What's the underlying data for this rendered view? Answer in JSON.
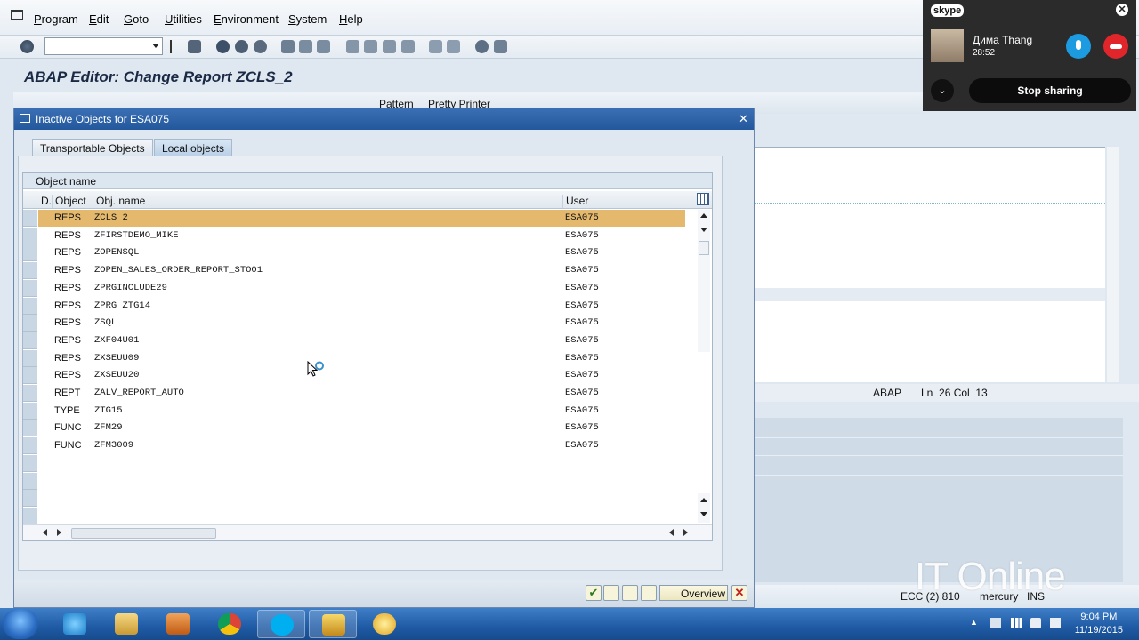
{
  "menu": [
    "Program",
    "Edit",
    "Goto",
    "Utilities",
    "Environment",
    "System",
    "Help"
  ],
  "page_title": "ABAP Editor: Change Report ZCLS_2",
  "appbar": {
    "pattern": "Pattern",
    "pretty_printer": "Pretty Printer"
  },
  "dialog": {
    "title": "Inactive Objects for ESA075",
    "tabs": [
      "Transportable Objects",
      "Local objects"
    ],
    "active_tab": "Local objects",
    "grid_caption": "Object name",
    "columns": {
      "d": "D..",
      "object": "Object",
      "obj_name": "Obj. name",
      "user": "User"
    },
    "rows": [
      {
        "object": "REPS",
        "name": "ZCLS_2",
        "user": "ESA075"
      },
      {
        "object": "REPS",
        "name": "ZFIRSTDEMO_MIKE",
        "user": "ESA075"
      },
      {
        "object": "REPS",
        "name": "ZOPENSQL",
        "user": "ESA075"
      },
      {
        "object": "REPS",
        "name": "ZOPEN_SALES_ORDER_REPORT_STO01",
        "user": "ESA075"
      },
      {
        "object": "REPS",
        "name": "ZPRGINCLUDE29",
        "user": "ESA075"
      },
      {
        "object": "REPS",
        "name": "ZPRG_ZTG14",
        "user": "ESA075"
      },
      {
        "object": "REPS",
        "name": "ZSQL",
        "user": "ESA075"
      },
      {
        "object": "REPS",
        "name": "ZXF04U01",
        "user": "ESA075"
      },
      {
        "object": "REPS",
        "name": "ZXSEUU09",
        "user": "ESA075"
      },
      {
        "object": "REPS",
        "name": "ZXSEUU20",
        "user": "ESA075"
      },
      {
        "object": "REPT",
        "name": "ZALV_REPORT_AUTO",
        "user": "ESA075"
      },
      {
        "object": "TYPE",
        "name": "ZTG15",
        "user": "ESA075"
      },
      {
        "object": "FUNC",
        "name": "ZFM29",
        "user": "ESA075"
      },
      {
        "object": "FUNC",
        "name": "ZFM3009",
        "user": "ESA075"
      }
    ],
    "overview_label": "Overview"
  },
  "editor_status": {
    "lang": "ABAP",
    "position": "Ln  26 Col  13"
  },
  "statusbar": {
    "system": "ECC (2) 810",
    "server": "mercury",
    "mode": "INS"
  },
  "watermark": "IT Online",
  "skype": {
    "logo": "skype",
    "contact": "Дима Thang",
    "timer": "28:52",
    "stop_label": "Stop sharing"
  },
  "clock": {
    "time": "9:04 PM",
    "date": "11/19/2015"
  },
  "colors": {
    "selected_row": "#e5b96d",
    "dialog_title": "#23589c",
    "taskbar": "#1f5aa5",
    "hangup": "#e0262b",
    "mic": "#1c9be0"
  }
}
